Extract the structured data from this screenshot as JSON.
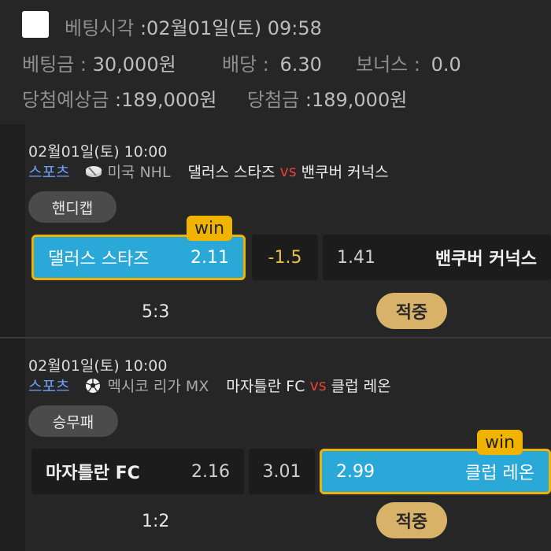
{
  "header": {
    "bet_time_label": "베팅시각",
    "bet_time_value": ":02월01일(토) 09:58",
    "stake_label": "베팅금 :",
    "stake_value": "30,000원",
    "odds_label": "배당 :",
    "odds_value": "6.30",
    "bonus_label": "보너스 :",
    "bonus_value": "0.0",
    "expected_label": "당첨예상금",
    "expected_value": ":189,000원",
    "win_label": "당첨금",
    "win_value": ":189,000원"
  },
  "bets": [
    {
      "datetime": "02월01일(토) 10:00",
      "category": "스포츠",
      "sport_icon": "hockey-puck-icon",
      "league": "미국 NHL",
      "home": "댈러스 스타즈",
      "vs": "vs",
      "away": "밴쿠버 커넉스",
      "market": "핸디캡",
      "home_odds": "2.11",
      "middle": "-1.5",
      "away_odds": "1.41",
      "win_badge": "win",
      "score": "5:3",
      "result": "적중"
    },
    {
      "datetime": "02월01일(토) 10:00",
      "category": "스포츠",
      "sport_icon": "soccer-ball-icon",
      "league": "멕시코 리가 MX",
      "home": "마자틀란 FC",
      "vs": "vs",
      "away": "클럽 레온",
      "market": "승무패",
      "home_odds": "2.16",
      "middle": "3.01",
      "away_odds": "2.99",
      "win_badge": "win",
      "score": "1:2",
      "result": "적중"
    }
  ]
}
